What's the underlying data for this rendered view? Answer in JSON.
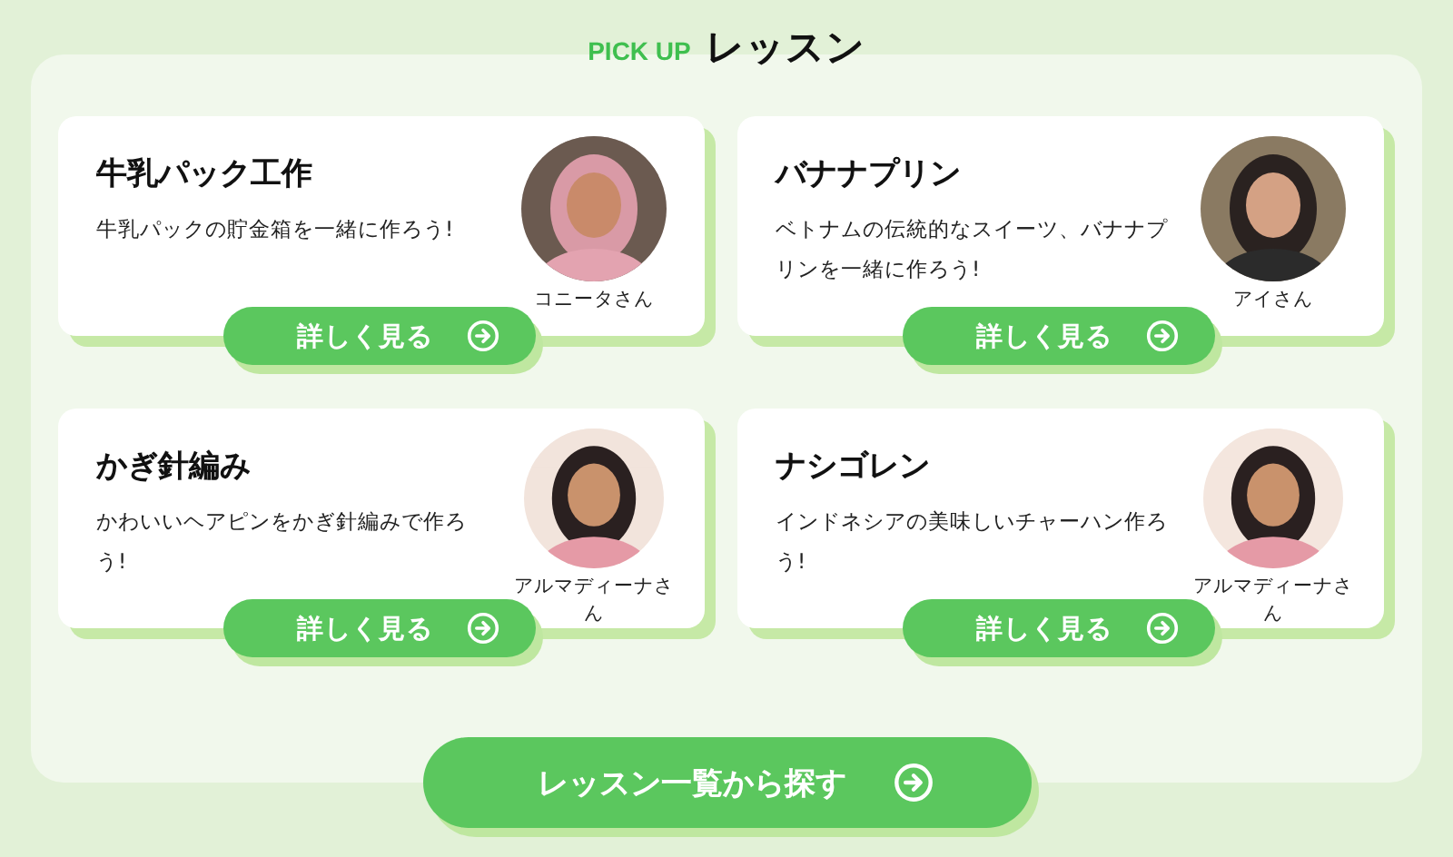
{
  "heading": {
    "eyebrow": "PICK UP",
    "title": "レッスン"
  },
  "lessons": [
    {
      "title": "牛乳パック工作",
      "description": "牛乳パックの貯金箱を一緒に作ろう!",
      "teacher": "コニータさん",
      "button": "詳しく見る"
    },
    {
      "title": "バナナプリン",
      "description": "ベトナムの伝統的なスイーツ、バナナプリンを一緒に作ろう!",
      "teacher": "アイさん",
      "button": "詳しく見る"
    },
    {
      "title": "かぎ針編み",
      "description": "かわいいヘアピンをかぎ針編みで作ろう!",
      "teacher": "アルマディーナさん",
      "button": "詳しく見る"
    },
    {
      "title": "ナシゴレン",
      "description": "インドネシアの美味しいチャーハン作ろう!",
      "teacher": "アルマディーナさん",
      "button": "詳しく見る"
    }
  ],
  "more_button": "レッスン一覧から探す"
}
